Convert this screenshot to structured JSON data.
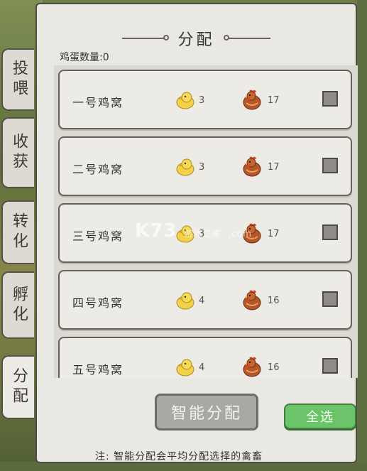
{
  "tabs": [
    {
      "label": "投喂",
      "active": false
    },
    {
      "label": "收获",
      "active": false
    },
    {
      "label": "转化",
      "active": false
    },
    {
      "label": "孵化",
      "active": false
    },
    {
      "label": "分配",
      "active": true
    }
  ],
  "panel": {
    "title": "分配",
    "egg_count_label": "鸡蛋数量:0"
  },
  "coops": [
    {
      "name": "一号鸡窝",
      "chicks": "3",
      "hens": "17",
      "checked": false
    },
    {
      "name": "二号鸡窝",
      "chicks": "3",
      "hens": "17",
      "checked": false
    },
    {
      "name": "三号鸡窝",
      "chicks": "3",
      "hens": "17",
      "checked": false
    },
    {
      "name": "四号鸡窝",
      "chicks": "4",
      "hens": "16",
      "checked": false
    },
    {
      "name": "五号鸡窝",
      "chicks": "4",
      "hens": "16",
      "checked": false
    }
  ],
  "icons": {
    "chick": "chick-icon",
    "hen": "hen-icon"
  },
  "buttons": {
    "smart_allocate": "智能分配",
    "select_all": "全选"
  },
  "note": "注: 智能分配会平均分配选择的禽畜",
  "watermark": {
    "main": "K73",
    "sub": "游戏之家",
    "url": ".com"
  },
  "colors": {
    "accent_green": "#6bc46a",
    "panel_bg": "#e9e8e3",
    "disabled_button": "#a9a8a3"
  }
}
